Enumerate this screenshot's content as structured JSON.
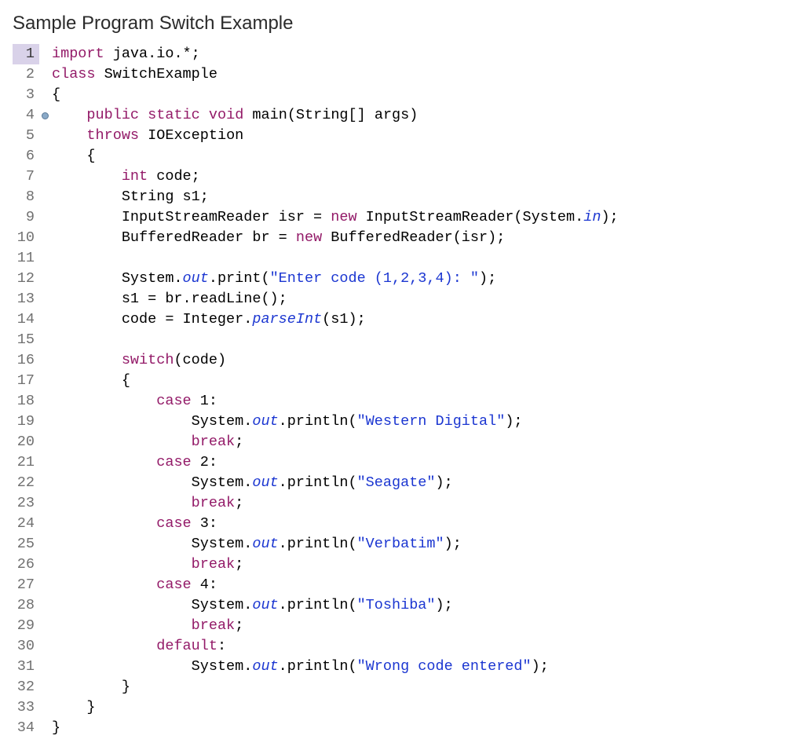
{
  "title": "Sample Program Switch Example",
  "lineNumbers": [
    "1",
    "2",
    "3",
    "4",
    "5",
    "6",
    "7",
    "8",
    "9",
    "10",
    "11",
    "12",
    "13",
    "14",
    "15",
    "16",
    "17",
    "18",
    "19",
    "20",
    "21",
    "22",
    "23",
    "24",
    "25",
    "26",
    "27",
    "28",
    "29",
    "30",
    "31",
    "32",
    "33",
    "34"
  ],
  "currentLine": 1,
  "foldAtLine": 4,
  "code": [
    [
      {
        "t": "kw",
        "v": "import"
      },
      {
        "t": "plain",
        "v": " java.io.*;"
      }
    ],
    [
      {
        "t": "kw",
        "v": "class"
      },
      {
        "t": "plain",
        "v": " SwitchExample"
      }
    ],
    [
      {
        "t": "plain",
        "v": "{"
      }
    ],
    [
      {
        "t": "plain",
        "v": "    "
      },
      {
        "t": "kw",
        "v": "public"
      },
      {
        "t": "plain",
        "v": " "
      },
      {
        "t": "kw",
        "v": "static"
      },
      {
        "t": "plain",
        "v": " "
      },
      {
        "t": "kw",
        "v": "void"
      },
      {
        "t": "plain",
        "v": " main(String[] args)"
      }
    ],
    [
      {
        "t": "plain",
        "v": "    "
      },
      {
        "t": "kw",
        "v": "throws"
      },
      {
        "t": "plain",
        "v": " IOException"
      }
    ],
    [
      {
        "t": "plain",
        "v": "    {"
      }
    ],
    [
      {
        "t": "plain",
        "v": "        "
      },
      {
        "t": "kw",
        "v": "int"
      },
      {
        "t": "plain",
        "v": " code;"
      }
    ],
    [
      {
        "t": "plain",
        "v": "        String s1;"
      }
    ],
    [
      {
        "t": "plain",
        "v": "        InputStreamReader isr = "
      },
      {
        "t": "kw",
        "v": "new"
      },
      {
        "t": "plain",
        "v": " InputStreamReader(System."
      },
      {
        "t": "ital",
        "v": "in"
      },
      {
        "t": "plain",
        "v": ");"
      }
    ],
    [
      {
        "t": "plain",
        "v": "        BufferedReader br = "
      },
      {
        "t": "kw",
        "v": "new"
      },
      {
        "t": "plain",
        "v": " BufferedReader(isr);"
      }
    ],
    [
      {
        "t": "plain",
        "v": ""
      }
    ],
    [
      {
        "t": "plain",
        "v": "        System."
      },
      {
        "t": "ital",
        "v": "out"
      },
      {
        "t": "plain",
        "v": ".print("
      },
      {
        "t": "str",
        "v": "\"Enter code (1,2,3,4): \""
      },
      {
        "t": "plain",
        "v": ");"
      }
    ],
    [
      {
        "t": "plain",
        "v": "        s1 = br.readLine();"
      }
    ],
    [
      {
        "t": "plain",
        "v": "        code = Integer."
      },
      {
        "t": "ital",
        "v": "parseInt"
      },
      {
        "t": "plain",
        "v": "(s1);"
      }
    ],
    [
      {
        "t": "plain",
        "v": ""
      }
    ],
    [
      {
        "t": "plain",
        "v": "        "
      },
      {
        "t": "kw",
        "v": "switch"
      },
      {
        "t": "plain",
        "v": "(code)"
      }
    ],
    [
      {
        "t": "plain",
        "v": "        {"
      }
    ],
    [
      {
        "t": "plain",
        "v": "            "
      },
      {
        "t": "kw",
        "v": "case"
      },
      {
        "t": "plain",
        "v": " 1:"
      }
    ],
    [
      {
        "t": "plain",
        "v": "                System."
      },
      {
        "t": "ital",
        "v": "out"
      },
      {
        "t": "plain",
        "v": ".println("
      },
      {
        "t": "str",
        "v": "\"Western Digital\""
      },
      {
        "t": "plain",
        "v": ");"
      }
    ],
    [
      {
        "t": "plain",
        "v": "                "
      },
      {
        "t": "kw",
        "v": "break"
      },
      {
        "t": "plain",
        "v": ";"
      }
    ],
    [
      {
        "t": "plain",
        "v": "            "
      },
      {
        "t": "kw",
        "v": "case"
      },
      {
        "t": "plain",
        "v": " 2:"
      }
    ],
    [
      {
        "t": "plain",
        "v": "                System."
      },
      {
        "t": "ital",
        "v": "out"
      },
      {
        "t": "plain",
        "v": ".println("
      },
      {
        "t": "str",
        "v": "\"Seagate\""
      },
      {
        "t": "plain",
        "v": ");"
      }
    ],
    [
      {
        "t": "plain",
        "v": "                "
      },
      {
        "t": "kw",
        "v": "break"
      },
      {
        "t": "plain",
        "v": ";"
      }
    ],
    [
      {
        "t": "plain",
        "v": "            "
      },
      {
        "t": "kw",
        "v": "case"
      },
      {
        "t": "plain",
        "v": " 3:"
      }
    ],
    [
      {
        "t": "plain",
        "v": "                System."
      },
      {
        "t": "ital",
        "v": "out"
      },
      {
        "t": "plain",
        "v": ".println("
      },
      {
        "t": "str",
        "v": "\"Verbatim\""
      },
      {
        "t": "plain",
        "v": ");"
      }
    ],
    [
      {
        "t": "plain",
        "v": "                "
      },
      {
        "t": "kw",
        "v": "break"
      },
      {
        "t": "plain",
        "v": ";"
      }
    ],
    [
      {
        "t": "plain",
        "v": "            "
      },
      {
        "t": "kw",
        "v": "case"
      },
      {
        "t": "plain",
        "v": " 4:"
      }
    ],
    [
      {
        "t": "plain",
        "v": "                System."
      },
      {
        "t": "ital",
        "v": "out"
      },
      {
        "t": "plain",
        "v": ".println("
      },
      {
        "t": "str",
        "v": "\"Toshiba\""
      },
      {
        "t": "plain",
        "v": ");"
      }
    ],
    [
      {
        "t": "plain",
        "v": "                "
      },
      {
        "t": "kw",
        "v": "break"
      },
      {
        "t": "plain",
        "v": ";"
      }
    ],
    [
      {
        "t": "plain",
        "v": "            "
      },
      {
        "t": "kw",
        "v": "default"
      },
      {
        "t": "plain",
        "v": ":"
      }
    ],
    [
      {
        "t": "plain",
        "v": "                System."
      },
      {
        "t": "ital",
        "v": "out"
      },
      {
        "t": "plain",
        "v": ".println("
      },
      {
        "t": "str",
        "v": "\"Wrong code entered\""
      },
      {
        "t": "plain",
        "v": ");"
      }
    ],
    [
      {
        "t": "plain",
        "v": "        }"
      }
    ],
    [
      {
        "t": "plain",
        "v": "    }"
      }
    ],
    [
      {
        "t": "plain",
        "v": "}"
      }
    ]
  ]
}
